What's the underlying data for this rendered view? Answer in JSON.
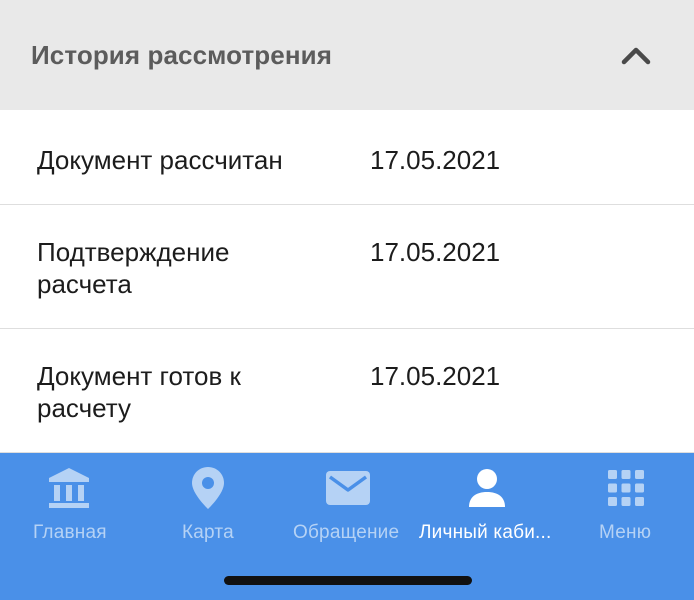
{
  "section": {
    "title": "История рассмотрения",
    "collapse_icon": "chevron-up-icon"
  },
  "history": [
    {
      "status": "Документ рассчитан",
      "date": "17.05.2021"
    },
    {
      "status": "Подтверждение расчета",
      "date": "17.05.2021"
    },
    {
      "status": "Документ готов к расчету",
      "date": "17.05.2021"
    }
  ],
  "tabbar": {
    "items": [
      {
        "label": "Главная",
        "icon": "building-icon"
      },
      {
        "label": "Карта",
        "icon": "map-pin-icon"
      },
      {
        "label": "Обращение",
        "icon": "envelope-icon"
      },
      {
        "label": "Личный каби...",
        "icon": "person-icon",
        "active": true
      },
      {
        "label": "Меню",
        "icon": "grid-icon"
      }
    ]
  },
  "colors": {
    "tabbar_bg": "#4a90e8",
    "tab_inactive": "#b5d2f5",
    "tab_active": "#ffffff",
    "header_bg": "#e9e9e9"
  }
}
